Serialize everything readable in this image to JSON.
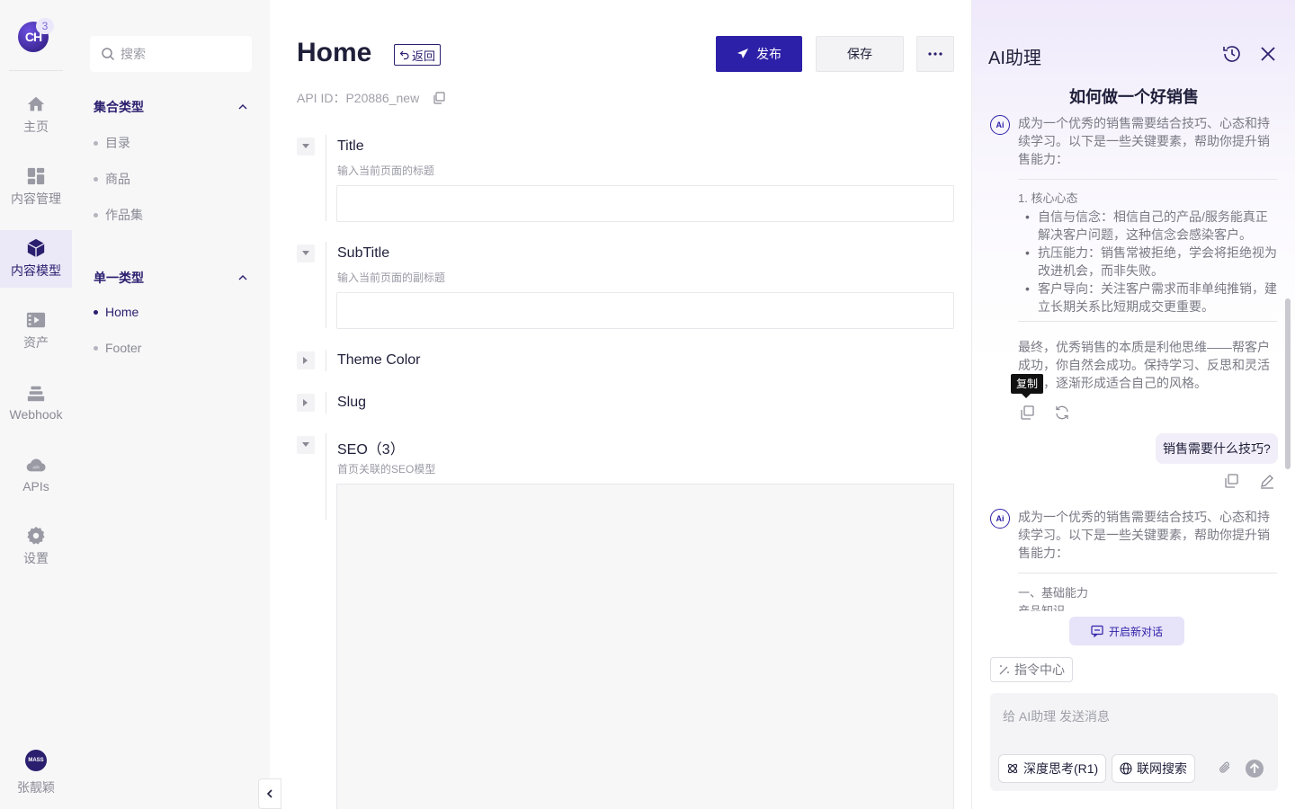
{
  "rail": {
    "logo_text": "CH",
    "badge": "3",
    "items": [
      {
        "label": "主页",
        "icon": "home-icon"
      },
      {
        "label": "内容管理",
        "icon": "dashboard-icon"
      },
      {
        "label": "内容模型",
        "icon": "cube-icon"
      },
      {
        "label": "资产",
        "icon": "media-icon"
      },
      {
        "label": "Webhook",
        "icon": "stack-icon"
      },
      {
        "label": "APIs",
        "icon": "api-cloud-icon"
      },
      {
        "label": "设置",
        "icon": "gear-icon"
      }
    ],
    "active_index": 2,
    "user": {
      "avatar_text": "MASS",
      "name": "张靓颖"
    }
  },
  "sidebar": {
    "search_placeholder": "搜索",
    "groups": [
      {
        "title": "集合类型",
        "items": [
          "目录",
          "商品",
          "作品集"
        ]
      },
      {
        "title": "单一类型",
        "items": [
          "Home",
          "Footer"
        ]
      }
    ],
    "active_item": "Home"
  },
  "editor": {
    "title": "Home",
    "back_label": "返回",
    "api_id": "API ID：P20886_new",
    "publish_label": "发布",
    "save_label": "保存",
    "fields": [
      {
        "name": "Title",
        "description": "输入当前页面的标题",
        "expanded": true
      },
      {
        "name": "SubTitle",
        "description": "输入当前页面的副标题",
        "expanded": true
      },
      {
        "name": "Theme Color",
        "description": "",
        "expanded": false
      },
      {
        "name": "Slug",
        "description": "",
        "expanded": false
      },
      {
        "name": "SEO（3）",
        "description": "首页关联的SEO模型",
        "expanded": true
      }
    ]
  },
  "ai_panel": {
    "title": "AI助理",
    "chat_heading": "如何做一个好销售",
    "ai_icon_text": "Ai",
    "reply1": {
      "intro": "成为一个优秀的销售需要结合技巧、心态和持续学习。以下是一些关键要素，帮助你提升销售能力：",
      "section": "1. 核心心态",
      "bullets": [
        "自信与信念：相信自己的产品/服务能真正解决客户问题，这种信念会感染客户。",
        "抗压能力：销售常被拒绝，学会将拒绝视为改进机会，而非失败。",
        "客户导向：关注客户需求而非单纯推销，建立长期关系比短期成交更重要。"
      ],
      "conclusion": "最终，优秀销售的本质是利他思维——帮客户成功，你自然会成功。保持学习、反思和灵活调整，逐渐形成适合自己的风格。"
    },
    "tooltip": "复制",
    "user_message": "销售需要什么技巧?",
    "reply2": {
      "intro": "成为一个优秀的销售需要结合技巧、心态和持续学习。以下是一些关键要素，帮助你提升销售能力：",
      "section": "一、基础能力",
      "truncated": "产品知识"
    },
    "new_chat_label": "开启新对话",
    "command_center_label": "指令中心",
    "input_placeholder": "给 AI助理 发送消息",
    "deep_think_label": "深度思考(R1)",
    "web_search_label": "联网搜索"
  },
  "colors": {
    "brand": "#2d20a8",
    "brand_dark": "#2a1e6e",
    "active_bg": "#ebe8f7"
  }
}
